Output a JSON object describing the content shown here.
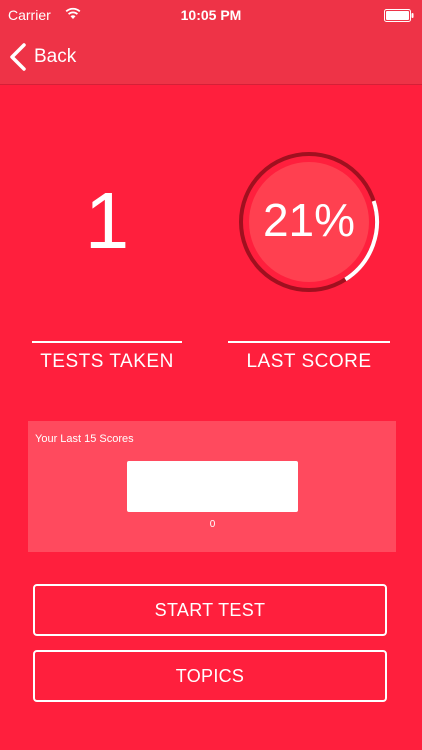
{
  "status_bar": {
    "carrier": "Carrier",
    "time": "10:05 PM",
    "wifi_icon": "wifi-icon",
    "battery_icon": "battery-icon"
  },
  "nav": {
    "back_label": "Back",
    "back_icon": "chevron-left-icon"
  },
  "stats": {
    "tests_taken_value": "1",
    "tests_taken_label": "TESTS TAKEN",
    "last_score_value": "21%",
    "last_score_label": "LAST SCORE",
    "last_score_fraction": 0.21
  },
  "scores_chart": {
    "title": "Your Last 15 Scores",
    "tick_label": "0"
  },
  "chart_data": {
    "type": "bar",
    "title": "Your Last 15 Scores",
    "categories": [
      "0"
    ],
    "values": [
      21
    ],
    "xlabel": "",
    "ylabel": ""
  },
  "buttons": {
    "start_test": "START TEST",
    "topics": "TOPICS"
  },
  "colors": {
    "background": "#ff1f3d",
    "nav_bar": "#ee3347",
    "panel": "#ff4a5e",
    "ring_track": "#a0101f",
    "ring_progress": "#ffffff",
    "ring_fill": "#ff4050"
  }
}
